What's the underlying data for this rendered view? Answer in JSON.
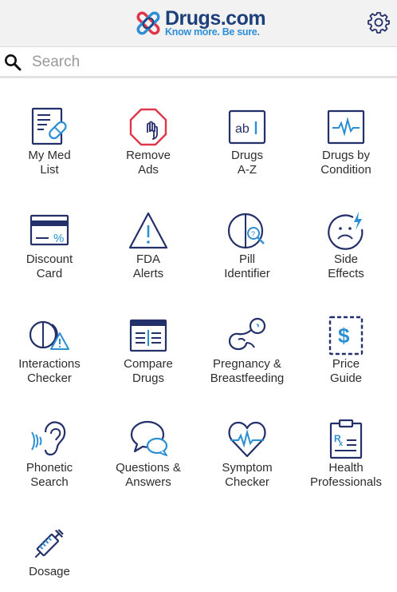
{
  "header": {
    "brand_name": "Drugs.com",
    "tagline": "Know more. Be sure.",
    "settings_icon": "gear-icon",
    "colors": {
      "brand_navy": "#1d3f7a",
      "brand_blue": "#2e8fd6"
    }
  },
  "search": {
    "placeholder": "Search",
    "icon": "search-icon"
  },
  "colors": {
    "icon_stroke": "#24306a",
    "accent_blue": "#2a8fd3",
    "accent_red": "#e0364a"
  },
  "tiles": [
    {
      "id": "my-med-list",
      "icon": "med-list-icon",
      "line1": "My Med",
      "line2": "List"
    },
    {
      "id": "remove-ads",
      "icon": "stop-hand-icon",
      "line1": "Remove",
      "line2": "Ads"
    },
    {
      "id": "drugs-a-z",
      "icon": "ab-box-icon",
      "line1": "Drugs",
      "line2": "A-Z"
    },
    {
      "id": "drugs-by-condition",
      "icon": "monitor-pulse-icon",
      "line1": "Drugs by",
      "line2": "Condition"
    },
    {
      "id": "discount-card",
      "icon": "discount-card-icon",
      "line1": "Discount",
      "line2": "Card"
    },
    {
      "id": "fda-alerts",
      "icon": "warning-triangle-icon",
      "line1": "FDA",
      "line2": "Alerts"
    },
    {
      "id": "pill-identifier",
      "icon": "pill-magnifier-icon",
      "line1": "Pill",
      "line2": "Identifier"
    },
    {
      "id": "side-effects",
      "icon": "sad-face-bolt-icon",
      "line1": "Side",
      "line2": "Effects"
    },
    {
      "id": "interactions-checker",
      "icon": "pills-warning-icon",
      "line1": "Interactions",
      "line2": "Checker"
    },
    {
      "id": "compare-drugs",
      "icon": "compare-card-icon",
      "line1": "Compare",
      "line2": "Drugs"
    },
    {
      "id": "pregnancy-breastfeeding",
      "icon": "baby-icon",
      "line1": "Pregnancy &",
      "line2": "Breastfeeding"
    },
    {
      "id": "price-guide",
      "icon": "dollar-coupon-icon",
      "line1": "Price",
      "line2": "Guide"
    },
    {
      "id": "phonetic-search",
      "icon": "ear-icon",
      "line1": "Phonetic",
      "line2": "Search"
    },
    {
      "id": "questions-answers",
      "icon": "speech-bubbles-icon",
      "line1": "Questions &",
      "line2": "Answers"
    },
    {
      "id": "symptom-checker",
      "icon": "heart-pulse-icon",
      "line1": "Symptom",
      "line2": "Checker"
    },
    {
      "id": "health-professionals",
      "icon": "rx-clipboard-icon",
      "line1": "Health",
      "line2": "Professionals"
    },
    {
      "id": "dosage",
      "icon": "syringe-icon",
      "line1": "Dosage",
      "line2": ""
    }
  ]
}
